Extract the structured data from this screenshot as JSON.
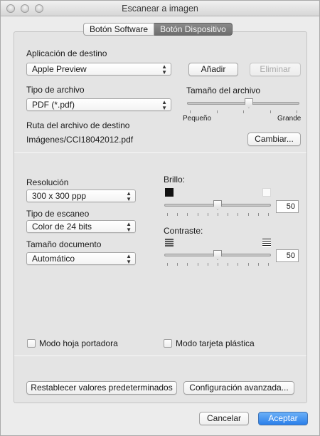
{
  "window": {
    "title": "Escanear a imagen"
  },
  "tabs": [
    {
      "label": "Botón Software",
      "selected": false
    },
    {
      "label": "Botón Dispositivo",
      "selected": true
    }
  ],
  "destination": {
    "label": "Aplicación de destino",
    "value": "Apple Preview",
    "add_label": "Añadir",
    "delete_label": "Eliminar"
  },
  "file_type": {
    "label": "Tipo de archivo",
    "value": "PDF (*.pdf)"
  },
  "file_size": {
    "label": "Tamaño del archivo",
    "min_label": "Pequeño",
    "max_label": "Grande",
    "level": 0.55
  },
  "dest_path": {
    "label": "Ruta del archivo de destino",
    "value": "Imágenes/CCI18042012.pdf",
    "change_label": "Cambiar..."
  },
  "resolution": {
    "label": "Resolución",
    "value": "300 x 300 ppp"
  },
  "scan_type": {
    "label": "Tipo de escaneo",
    "value": "Color de 24 bits"
  },
  "doc_size": {
    "label": "Tamaño documento",
    "value": "Automático"
  },
  "brightness": {
    "label": "Brillo:",
    "value": "50",
    "level": 0.5
  },
  "contrast": {
    "label": "Contraste:",
    "value": "50",
    "level": 0.5
  },
  "options": {
    "carrier_sheet": "Modo hoja portadora",
    "plastic_card": "Modo tarjeta plástica"
  },
  "buttons": {
    "restore_defaults": "Restablecer valores predeterminados",
    "advanced": "Configuración avanzada...",
    "cancel": "Cancelar",
    "accept": "Aceptar"
  },
  "colors": {
    "accent": "#2a7fea",
    "tab_selected": "#7a7a7a"
  }
}
